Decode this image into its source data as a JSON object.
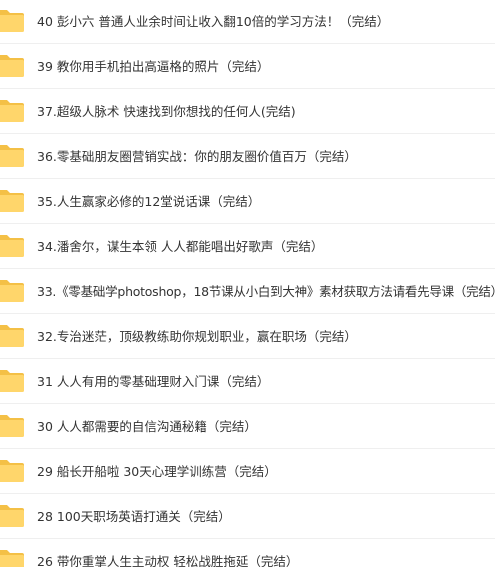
{
  "colors": {
    "folder_body": "#ffd66b",
    "folder_tab": "#f4c046",
    "text": "#333333",
    "divider": "#efefef"
  },
  "files": [
    {
      "icon": "folder-icon",
      "name": "40 彭小六 普通人业余时间让收入翻10倍的学习方法！（完结）"
    },
    {
      "icon": "folder-icon",
      "name": "39 教你用手机拍出高逼格的照片（完结）"
    },
    {
      "icon": "folder-icon",
      "name": "37.超级人脉术 快速找到你想找的任何人(完结)"
    },
    {
      "icon": "folder-icon",
      "name": "36.零基础朋友圈营销实战：你的朋友圈价值百万（完结）"
    },
    {
      "icon": "folder-icon",
      "name": "35.人生赢家必修的12堂说话课（完结）"
    },
    {
      "icon": "folder-icon",
      "name": "34.潘舍尔，谋生本领 人人都能唱出好歌声（完结）"
    },
    {
      "icon": "folder-icon",
      "name": "33.《零基础学photoshop，18节课从小白到大神》素材获取方法请看先导课（完结）"
    },
    {
      "icon": "folder-icon",
      "name": "32.专治迷茫，顶级教练助你规划职业，赢在职场（完结）"
    },
    {
      "icon": "folder-icon",
      "name": "31 人人有用的零基础理财入门课（完结）"
    },
    {
      "icon": "folder-icon",
      "name": "30 人人都需要的自信沟通秘籍（完结）"
    },
    {
      "icon": "folder-icon",
      "name": "29 船长开船啦 30天心理学训练营（完结）"
    },
    {
      "icon": "folder-icon",
      "name": "28 100天职场英语打通关（完结）"
    },
    {
      "icon": "folder-icon",
      "name": "26 带你重掌人生主动权 轻松战胜拖延（完结）"
    }
  ]
}
